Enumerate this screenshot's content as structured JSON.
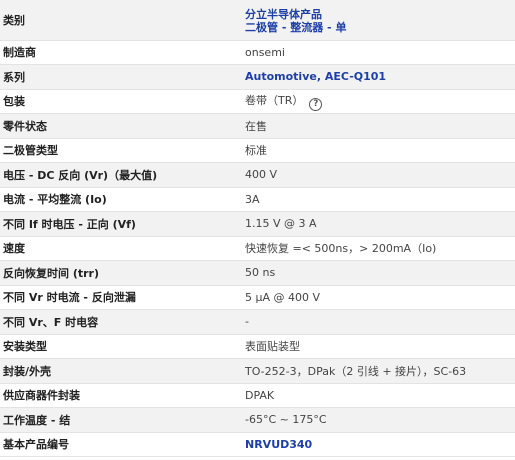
{
  "header": {
    "label": "类别",
    "value_line1": "分立半导体产品",
    "value_line2": "二极管 - 整流器 - 单"
  },
  "rows": [
    {
      "label": "制造商",
      "value": "onsemi"
    },
    {
      "label": "系列",
      "value": "Automotive, AEC-Q101"
    },
    {
      "label": "包装",
      "value": "卷带（TR）"
    },
    {
      "label": "零件状态",
      "value": "在售"
    },
    {
      "label": "二极管类型",
      "value": "标准"
    },
    {
      "label": "电压 - DC 反向 (Vr)（最大值)",
      "value": "400 V"
    },
    {
      "label": "电流 - 平均整流 (Io)",
      "value": "3A"
    },
    {
      "label": "不同 If 时电压 - 正向 (Vf)",
      "value": "1.15 V @ 3 A"
    },
    {
      "label": "速度",
      "value": "快速恢复 =< 500ns，> 200mA（Io)"
    },
    {
      "label": "反向恢复时间 (trr)",
      "value": "50 ns"
    },
    {
      "label": "不同 Vr 时电流 - 反向泄漏",
      "value": "5 µA @ 400 V"
    },
    {
      "label": "不同 Vr、F 时电容",
      "value": "-"
    },
    {
      "label": "安装类型",
      "value": "表面贴装型"
    },
    {
      "label": "封装/外壳",
      "value": "TO-252-3，DPak（2 引线 + 接片），SC-63"
    },
    {
      "label": "供应商器件封装",
      "value": "DPAK"
    },
    {
      "label": "工作温度 - 结",
      "value": "-65°C ~ 175°C"
    },
    {
      "label": "基本产品编号",
      "value": "NRVUD340"
    }
  ],
  "help_icon": {
    "glyph": "?",
    "icon": "question-circle-icon"
  },
  "colors": {
    "link": "#1d3fa8",
    "row_alt": "#f2f2f2"
  }
}
